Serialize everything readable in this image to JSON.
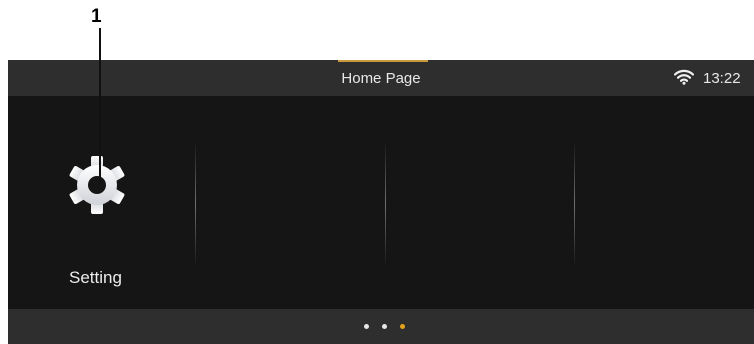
{
  "callout": {
    "number": "1"
  },
  "status_bar": {
    "title": "Home Page",
    "time": "13:22",
    "wifi_icon": "wifi-icon"
  },
  "home": {
    "apps": [
      {
        "label": "Setting",
        "icon": "gear-icon"
      }
    ]
  },
  "pager": {
    "page_count": 3,
    "active_index": 2
  },
  "colors": {
    "status_bg": "#2e2e2e",
    "screen_bg": "#151515",
    "accent": "#c99a3b",
    "active_dot": "#e3a21a",
    "text": "#e8e8e8"
  }
}
